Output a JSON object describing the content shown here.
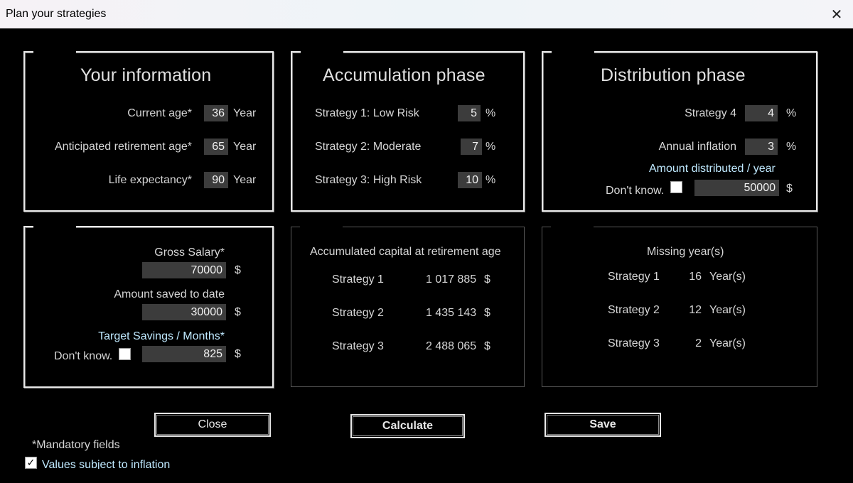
{
  "window": {
    "title": "Plan your strategies"
  },
  "info": {
    "heading": "Your information",
    "current_age_label": "Current age*",
    "current_age": "36",
    "current_age_unit": "Year",
    "retirement_age_label": "Anticipated retirement age*",
    "retirement_age": "65",
    "retirement_age_unit": "Year",
    "life_exp_label": "Life expectancy*",
    "life_exp": "90",
    "life_exp_unit": "Year"
  },
  "accumulation": {
    "heading": "Accumulation phase",
    "s1_label": "Strategy 1: Low Risk",
    "s1_value": "5",
    "s1_unit": "%",
    "s2_label": "Strategy 2: Moderate",
    "s2_value": "7",
    "s2_unit": "%",
    "s3_label": "Strategy 3: High Risk",
    "s3_value": "10",
    "s3_unit": "%"
  },
  "distribution": {
    "heading": "Distribution phase",
    "s4_label": "Strategy 4",
    "s4_value": "4",
    "s4_unit": "%",
    "inflation_label": "Annual inflation",
    "inflation_value": "3",
    "inflation_unit": "%",
    "amount_label": "Amount distributed / year",
    "dont_know_label": "Don't know.",
    "amount_value": "50000",
    "amount_unit": "$"
  },
  "savings": {
    "salary_label": "Gross Salary*",
    "salary_value": "70000",
    "salary_unit": "$",
    "saved_label": "Amount saved to date",
    "saved_value": "30000",
    "saved_unit": "$",
    "target_label": "Target Savings / Months*",
    "dont_know_label": "Don't know.",
    "target_value": "825",
    "target_unit": "$"
  },
  "capital": {
    "title": "Accumulated capital at retirement age",
    "rows": [
      {
        "label": "Strategy 1",
        "value": "1 017 885",
        "unit": "$"
      },
      {
        "label": "Strategy 2",
        "value": "1 435 143",
        "unit": "$"
      },
      {
        "label": "Strategy 3",
        "value": "2 488 065",
        "unit": "$"
      }
    ]
  },
  "missing": {
    "title": "Missing year(s)",
    "rows": [
      {
        "label": "Strategy 1",
        "value": "16",
        "unit": "Year(s)"
      },
      {
        "label": "Strategy 2",
        "value": "12",
        "unit": "Year(s)"
      },
      {
        "label": "Strategy 3",
        "value": "2",
        "unit": "Year(s)"
      }
    ]
  },
  "buttons": {
    "close": "Close",
    "calculate": "Calculate",
    "save": "Save"
  },
  "footer": {
    "mandatory": "*Mandatory fields",
    "inflation_checkbox": "Values subject to inflation"
  },
  "icons": {
    "window_close": "close-icon",
    "checkbox_checked": "checkmark-icon"
  }
}
